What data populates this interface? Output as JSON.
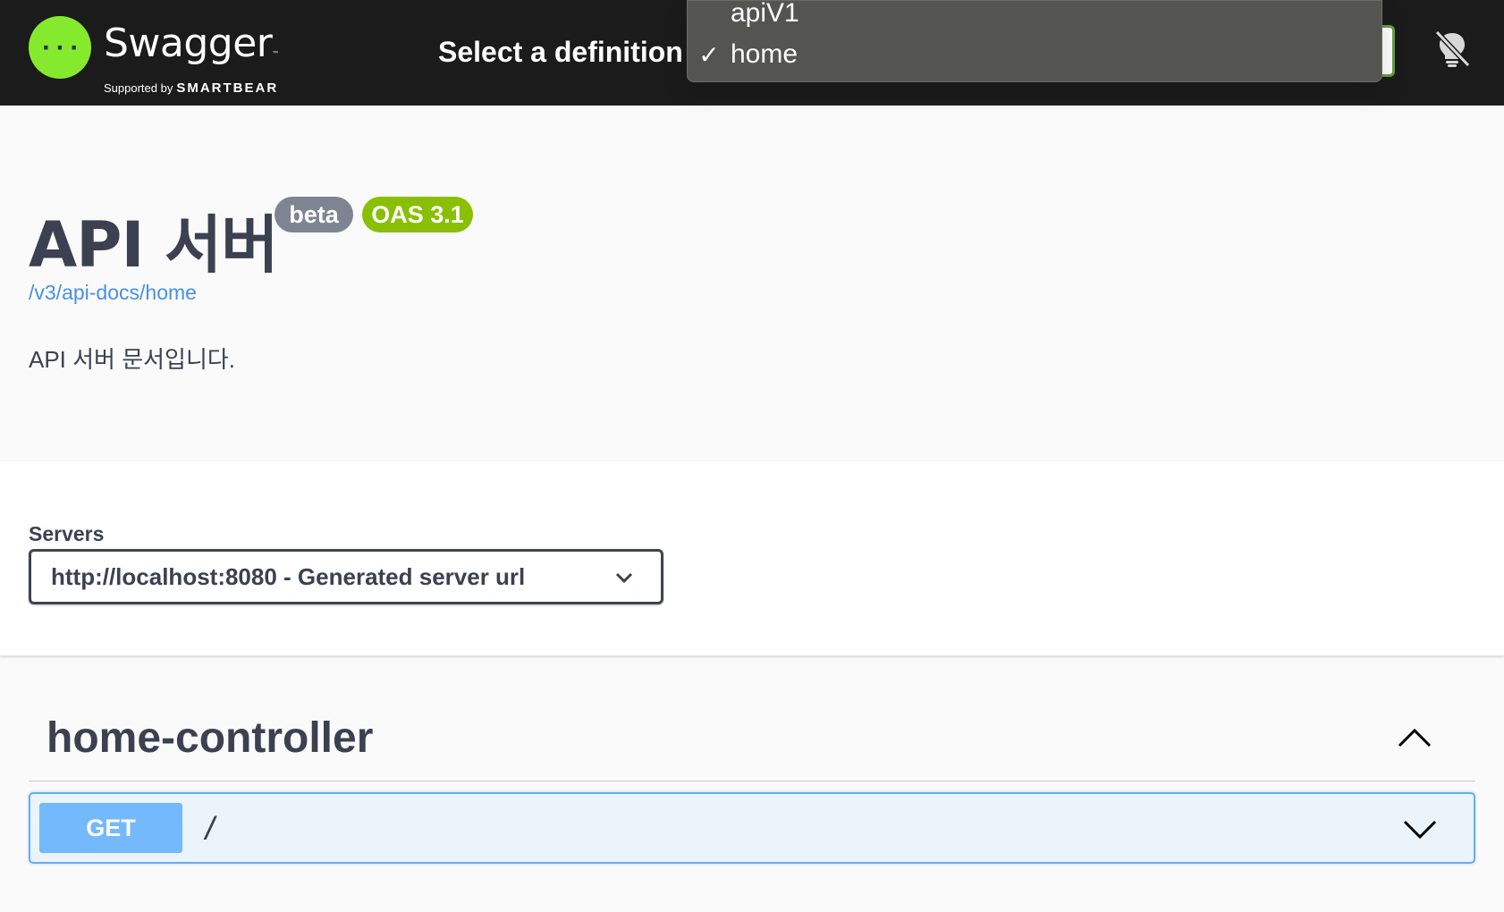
{
  "topbar": {
    "brand": "Swagger",
    "trademark": "™",
    "supported_by": "Supported by",
    "smartbear": "SMARTBEAR",
    "select_label": "Select a definition",
    "bulb_icon": "lightbulb-off-icon"
  },
  "definition_dropdown": {
    "options": [
      {
        "label": "apiV1",
        "selected": false
      },
      {
        "label": "home",
        "selected": true
      }
    ],
    "check_mark": "✓"
  },
  "info": {
    "title": "API 서버",
    "badge_beta": "beta",
    "badge_oas": "OAS 3.1",
    "spec_url": "/v3/api-docs/home",
    "description": "API 서버 문서입니다."
  },
  "servers": {
    "label": "Servers",
    "selected": "http://localhost:8080 - Generated server url"
  },
  "tags": [
    {
      "name": "home-controller",
      "expanded": true,
      "operations": [
        {
          "method": "GET",
          "path": "/"
        }
      ]
    }
  ],
  "colors": {
    "topbar_bg": "#1b1b1b",
    "logo_green": "#85ea2d",
    "oas_badge": "#89bf04",
    "beta_badge": "#7d8492",
    "get_blue": "#61affe",
    "link_blue": "#4990e2"
  }
}
